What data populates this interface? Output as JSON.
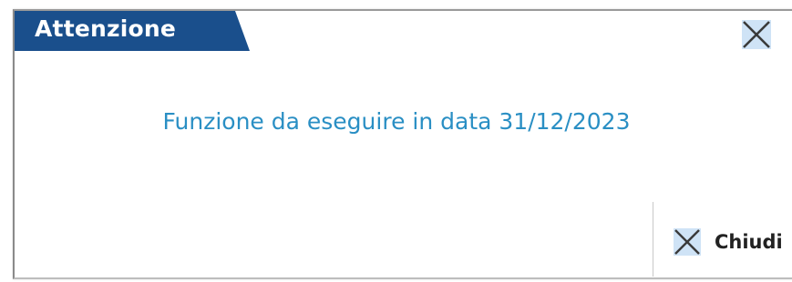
{
  "dialog": {
    "title": "Attenzione",
    "message": "Funzione da eseguire in data 31/12/2023",
    "close_icon": "close-icon",
    "buttons": [
      {
        "label": "Chiudi",
        "icon": "close-icon"
      }
    ]
  },
  "colors": {
    "title_bar": "#1a4f8c",
    "message_text": "#2a8fc4",
    "icon_highlight": "#cfe3f6"
  }
}
